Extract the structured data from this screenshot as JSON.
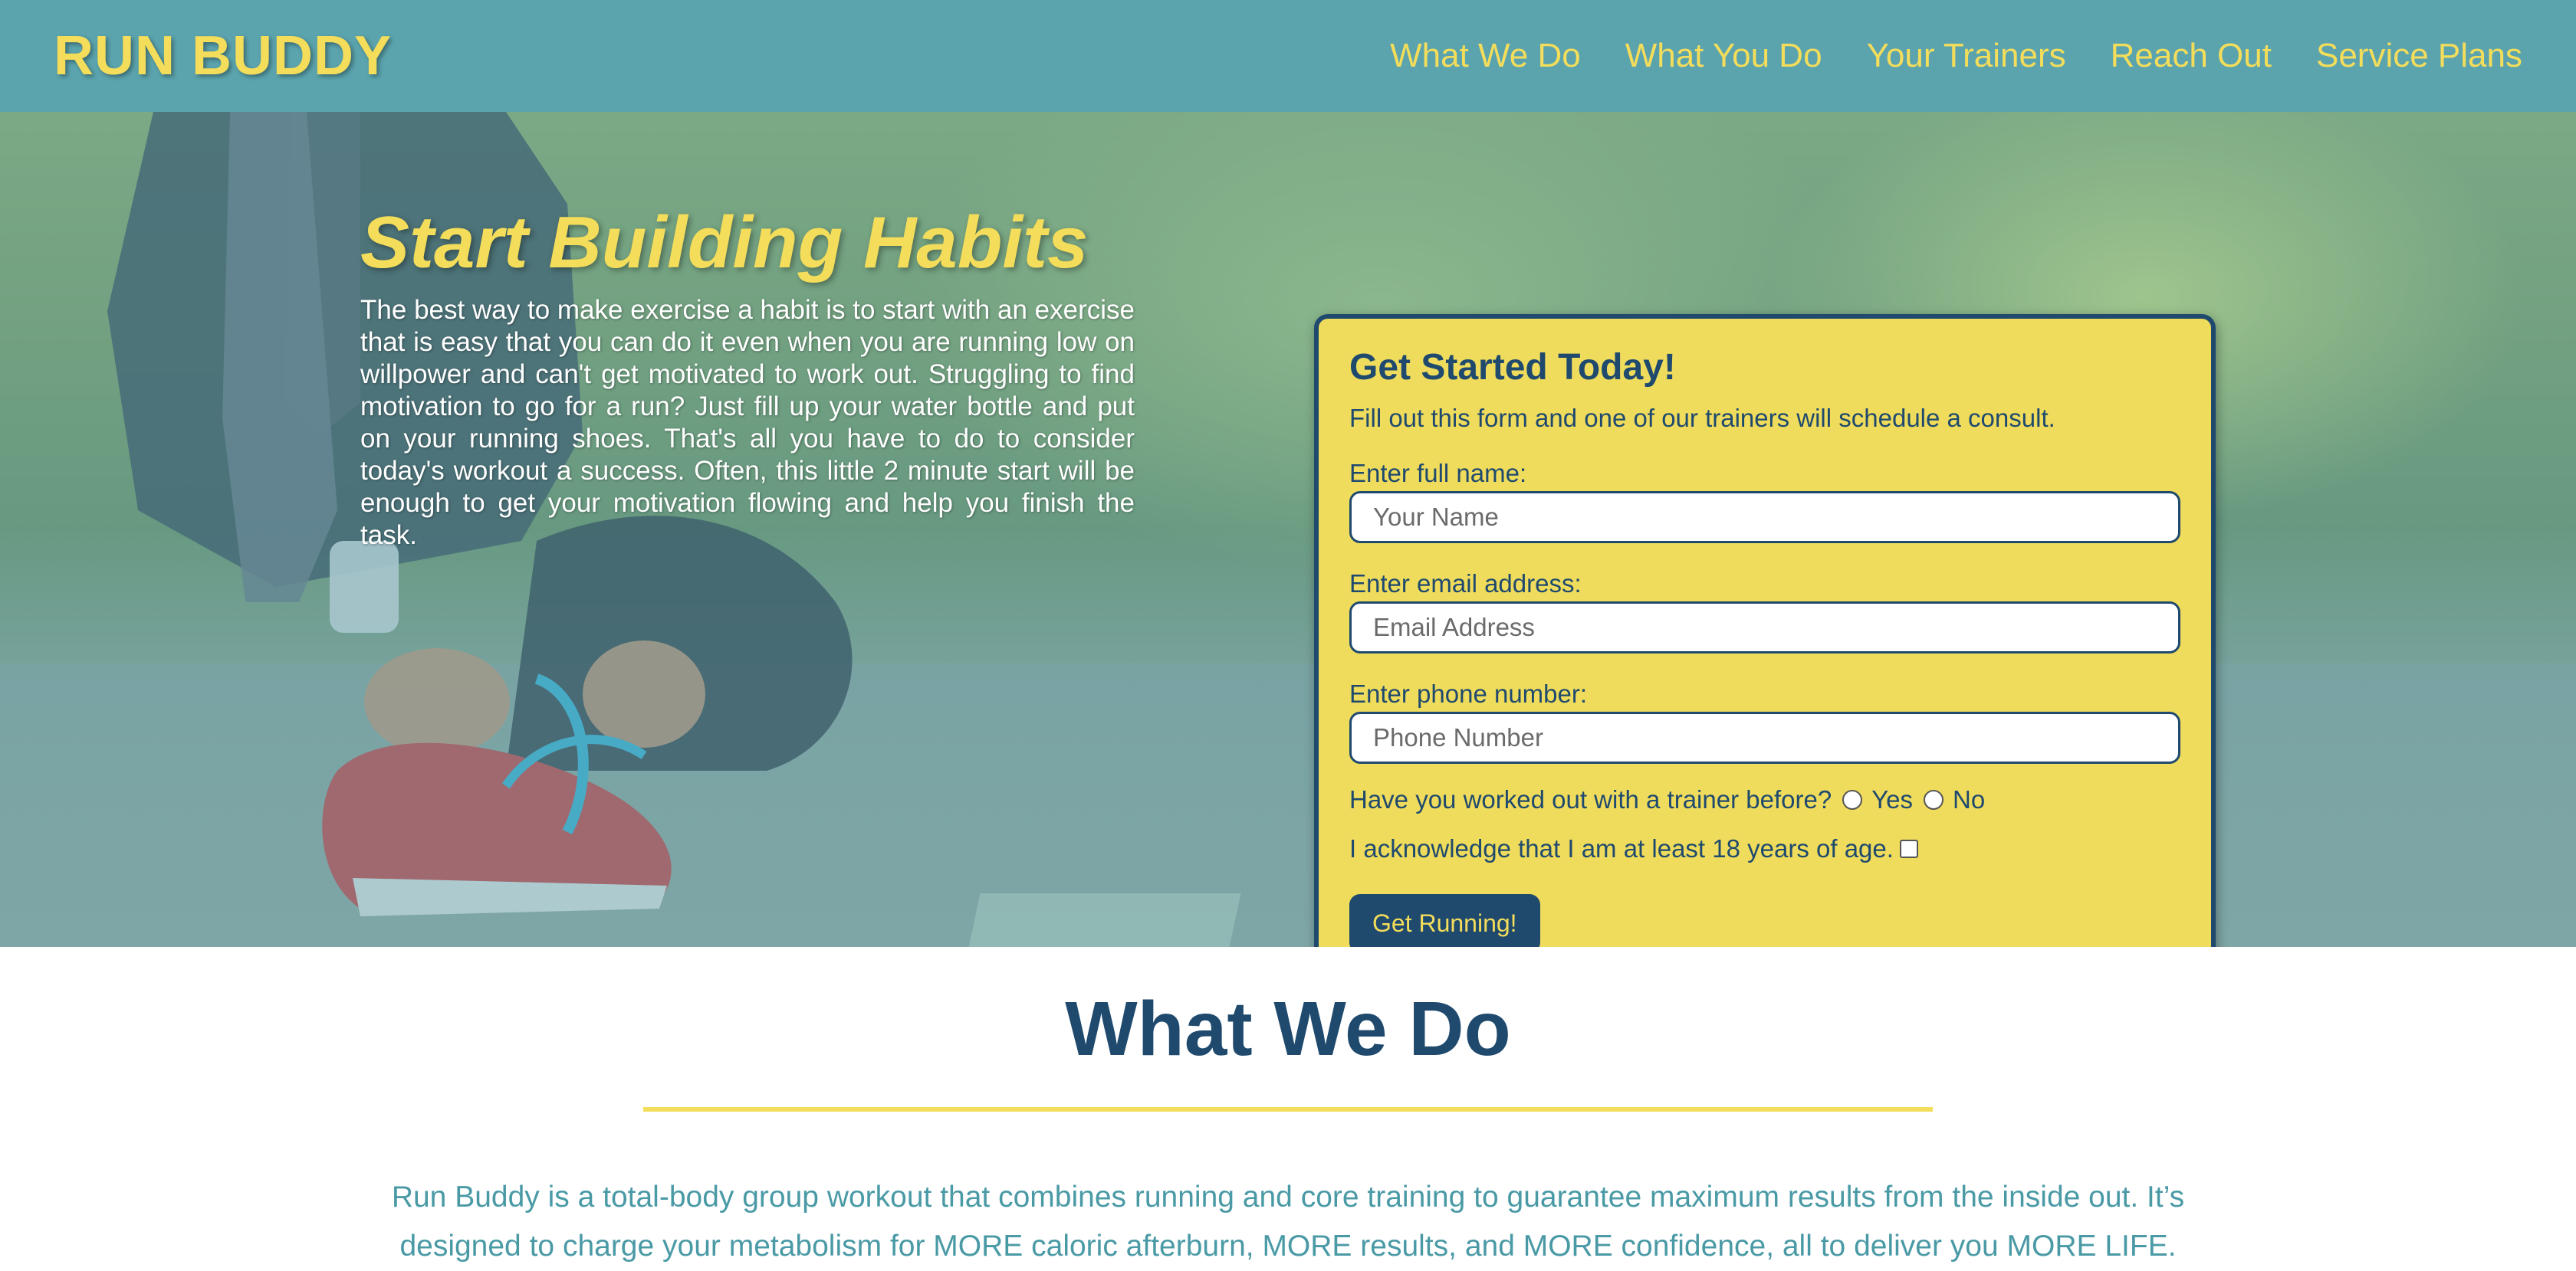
{
  "header": {
    "logo": "RUN BUDDY",
    "nav": [
      "What We Do",
      "What You Do",
      "Your Trainers",
      "Reach Out",
      "Service Plans"
    ]
  },
  "hero": {
    "title": "Start Building Habits",
    "body": "The best way to make exercise a habit is to start with an exercise that is easy that you can do it even when you are running low on willpower and can't get motivated to work out. Struggling to find motivation to go for a run? Just fill up your water bottle and put on your running shoes. That's all you have to do to consider today's workout a success. Often, this little 2 minute start will be enough to get your motivation flowing and help you finish the task."
  },
  "form": {
    "title": "Get Started Today!",
    "intro": "Fill out this form and one of our trainers will schedule a consult.",
    "name_label": "Enter full name:",
    "name_placeholder": "Your Name",
    "email_label": "Enter email address:",
    "email_placeholder": "Email Address",
    "phone_label": "Enter phone number:",
    "phone_placeholder": "Phone Number",
    "trainer_question": "Have you worked out with a trainer before?",
    "radio_yes": "Yes",
    "radio_no": "No",
    "age_ack": "I acknowledge that I am at least 18 years of age.",
    "submit_label": "Get Running!"
  },
  "what_we_do": {
    "title": "What We Do",
    "body": "Run Buddy is a total-body group workout that combines running and core training to guarantee maximum results from the inside out. It’s designed to charge your metabolism for MORE caloric afterburn, MORE results, and MORE confidence, all to deliver you MORE LIFE."
  },
  "colors": {
    "teal": "#5ba4ae",
    "yellow": "#f4dd5a",
    "navy": "#1f4a6e",
    "body_teal": "#4a9aa6"
  }
}
